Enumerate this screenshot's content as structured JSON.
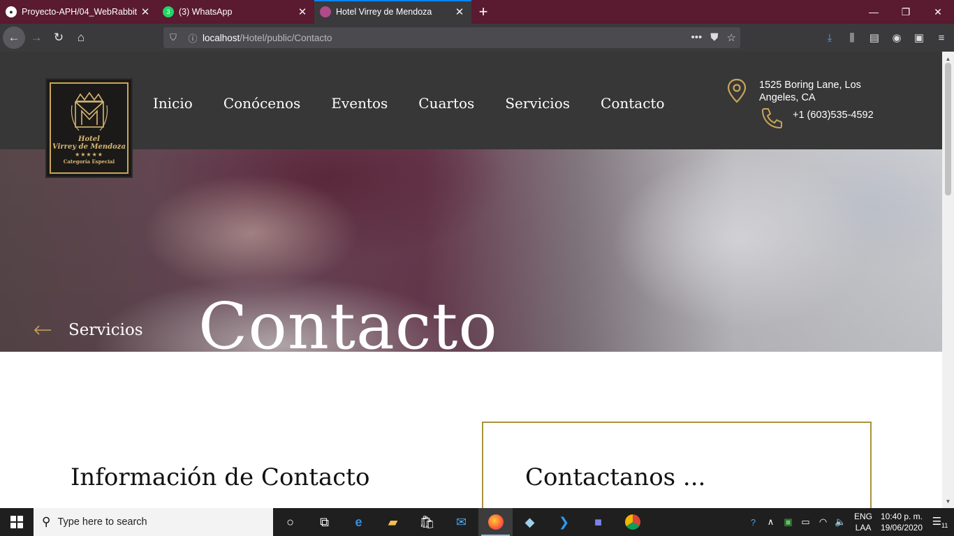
{
  "browser": {
    "tabs": [
      {
        "title": "Proyecto-APH/04_WebRabbit",
        "icon": "github-icon",
        "active": false
      },
      {
        "title": "(3) WhatsApp",
        "icon": "whatsapp-icon",
        "badge": "3",
        "active": false
      },
      {
        "title": "Hotel Virrey de Mendoza",
        "icon": "site-icon",
        "active": true
      }
    ],
    "new_tab": "+",
    "url_host": "localhost",
    "url_path": "/Hotel/public/Contacto",
    "url_actions": "•••"
  },
  "site": {
    "logo": {
      "line1": "Hotel",
      "line2": "Virrey de Mendoza",
      "stars": "★★★★★",
      "line4": "Categoría Especial"
    },
    "nav": [
      "Inicio",
      "Conócenos",
      "Eventos",
      "Cuartos",
      "Servicios",
      "Contacto"
    ],
    "address": "1525 Boring Lane, Los Angeles, CA",
    "phone": "+1 (603)535-4592",
    "accent_color": "#c9a55a",
    "header_color": "#373737"
  },
  "hero": {
    "back_label": "Servicios",
    "title": "Contacto"
  },
  "content": {
    "info_title": "Información de Contacto",
    "form_title": "Contactanos ...",
    "box_border_color": "#a9933d"
  },
  "taskbar": {
    "search_placeholder": "Type here to search",
    "lang_line1": "ENG",
    "lang_line2": "LAA",
    "time": "10:40 p. m.",
    "date": "19/06/2020",
    "notification_count": "11"
  }
}
